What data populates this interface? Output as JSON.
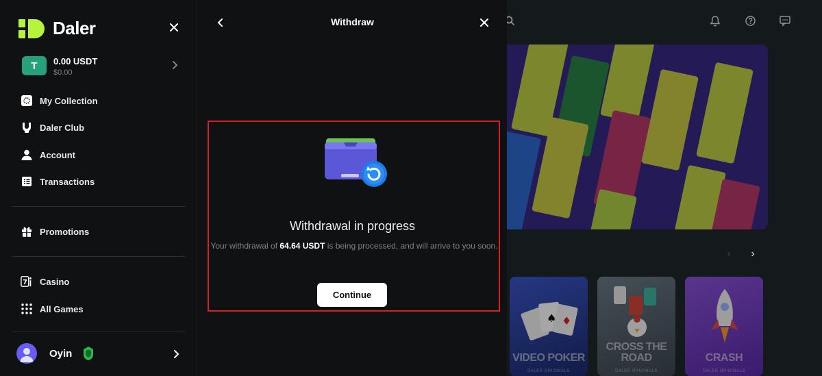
{
  "brand": {
    "name": "Daler",
    "accent_color": "#b7f23e"
  },
  "balance": {
    "amount": "0.00 USDT",
    "usd": "$0.00",
    "currency_icon": "tether-icon",
    "currency_color": "#26a17b"
  },
  "nav": {
    "main": [
      {
        "label": "My Collection",
        "icon": "collection-icon"
      },
      {
        "label": "Daler Club",
        "icon": "club-icon"
      },
      {
        "label": "Account",
        "icon": "user-icon"
      },
      {
        "label": "Transactions",
        "icon": "list-icon"
      }
    ],
    "promotions": {
      "label": "Promotions",
      "icon": "gift-icon"
    },
    "games": [
      {
        "label": "Casino",
        "icon": "casino-icon"
      },
      {
        "label": "All Games",
        "icon": "grid-icon"
      }
    ]
  },
  "user": {
    "name": "Oyin",
    "avatar_color": "#6a5cf0"
  },
  "modal": {
    "title": "Withdraw",
    "status_title": "Withdrawal in progress",
    "message_prefix": "Your withdrawal of ",
    "amount": "64.64 USDT",
    "message_suffix": " is being processed, and will arrive to you soon.",
    "continue_label": "Continue",
    "highlight_color": "#d91f26"
  },
  "games": [
    {
      "title": "VIDEO POKER",
      "subtitle": "DALER ORIGINALS"
    },
    {
      "title": "CROSS THE ROAD",
      "subtitle": "DALER ORIGINALS"
    },
    {
      "title": "CRASH",
      "subtitle": "DALER ORIGINALS"
    }
  ],
  "topbar_icons": [
    "search-icon",
    "bell-icon",
    "help-icon",
    "chat-icon"
  ]
}
